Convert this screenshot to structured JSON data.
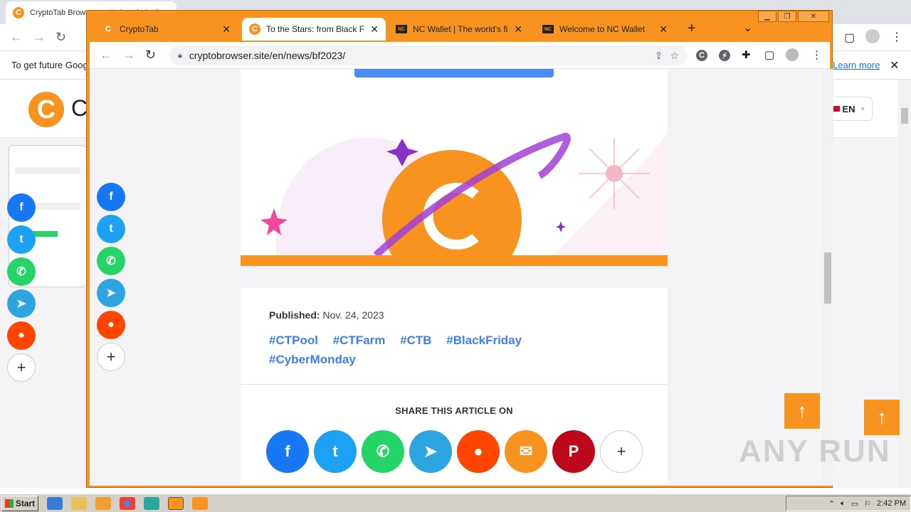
{
  "background_browser": {
    "tab_title": "CryptoTab Browser — Web website for ...",
    "infobar_text": "To get future Goog",
    "infobar_link": "Learn more",
    "logo_letter": "C",
    "site_name_partial": "C",
    "lang_label": "EN",
    "up_arrow": "↑"
  },
  "window": {
    "controls": {
      "minimize": "▁",
      "restore": "❐",
      "close": "✕"
    },
    "tabs": [
      {
        "title": "CryptoTab",
        "icon": "cryptotab-icon"
      },
      {
        "title": "To the Stars: from Black Friday",
        "icon": "cryptotab-icon"
      },
      {
        "title": "NC Wallet | The world's first c",
        "icon": "ncwallet-icon"
      },
      {
        "title": "Welcome to NC Wallet",
        "icon": "ncwallet-icon"
      }
    ],
    "new_tab": "+",
    "tab_list": "⌄",
    "url": "cryptobrowser.site/en/news/bf2023/"
  },
  "article": {
    "published_label": "Published:",
    "published_date": "Nov. 24, 2023",
    "tags": [
      "#CTPool",
      "#CTFarm",
      "#CTB",
      "#BlackFriday",
      "#CyberMonday"
    ],
    "share_title": "SHARE THIS ARTICLE ON",
    "up_arrow": "↑"
  },
  "share_icons": [
    "facebook-icon",
    "twitter-icon",
    "whatsapp-icon",
    "telegram-icon",
    "reddit-icon",
    "email-icon",
    "pinterest-icon",
    "more-icon"
  ],
  "watermark": "ANY RUN",
  "taskbar": {
    "start": "Start",
    "time": "2:42 PM"
  },
  "colors": {
    "accent": "#f7931e",
    "link": "#3d7fe6"
  }
}
